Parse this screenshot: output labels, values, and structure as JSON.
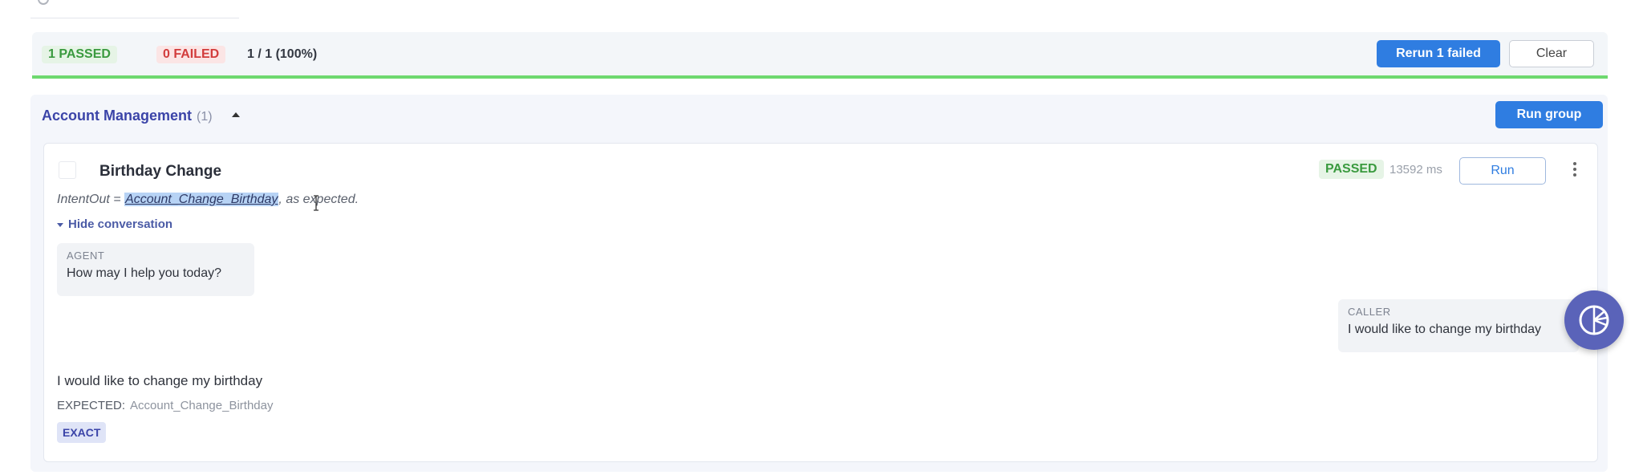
{
  "summary": {
    "passed_label": "1 PASSED",
    "failed_label": "0 FAILED",
    "ratio": "1 / 1 (100%)",
    "rerun_label": "Rerun 1 failed",
    "clear_label": "Clear",
    "progress_fraction": 1.0
  },
  "group": {
    "title": "Account Management",
    "count": "(1)",
    "run_group_label": "Run group"
  },
  "test": {
    "title": "Birthday Change",
    "status": "PASSED",
    "duration": "13592 ms",
    "run_label": "Run",
    "intent_prefix": "IntentOut = ",
    "intent_value": "Account_Change_Birthday",
    "intent_suffix": ", as expected.",
    "toggle_label": "Hide conversation",
    "agent_role": "AGENT",
    "agent_message": "How may I help you today?",
    "caller_role": "CALLER",
    "caller_message": "I would like to change my birthday",
    "utterance": "I would like to change my birthday",
    "expected_label": "EXPECTED:",
    "expected_value": "Account_Change_Birthday",
    "match_type": "EXACT"
  },
  "colors": {
    "primary": "#2f7de1",
    "success": "#3a9a3f",
    "failure": "#d23c3c",
    "progress": "#6ed96f",
    "group_title": "#3b44a8"
  },
  "icons": [
    "search-icon",
    "caret-up-icon",
    "kebab-menu-icon",
    "triangle-down-icon",
    "assistant-icon"
  ]
}
